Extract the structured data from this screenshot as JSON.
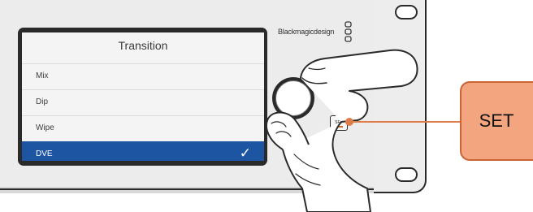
{
  "lcd": {
    "title": "Transition",
    "items": [
      {
        "label": "Mix",
        "selected": false
      },
      {
        "label": "Dip",
        "selected": false
      },
      {
        "label": "Wipe",
        "selected": false
      },
      {
        "label": "DVE",
        "selected": true
      }
    ],
    "selected_check": "✓"
  },
  "logo": {
    "text": "Blackmagicdesign"
  },
  "buttons": {
    "set_small_label": "SET"
  },
  "callout": {
    "label": "SET"
  },
  "colors": {
    "lcd_selection": "#1d55a3",
    "callout_fill": "#f2a57f",
    "callout_border": "#c96436",
    "callout_line": "#e07b4a"
  },
  "icons": [
    "check-icon",
    "blackmagic-logo-icon",
    "hand-icon",
    "knob-icon"
  ]
}
